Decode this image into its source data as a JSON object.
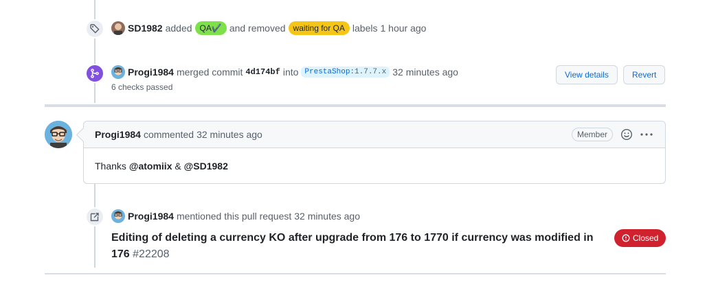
{
  "events": {
    "label_event": {
      "actor": "SD1982",
      "added_text": "added",
      "added_label": "QA✔️",
      "removed_text": "and removed",
      "removed_label": "waiting for QA",
      "suffix": "labels",
      "time": "1 hour ago",
      "icon": "tag-icon"
    },
    "merge_event": {
      "actor": "Progi1984",
      "merged_text": "merged commit",
      "commit_sha": "4d174bf",
      "into_text": "into",
      "branch_owner": "PrestaShop",
      "branch_name": ":1.7.7.x",
      "time": "32 minutes ago",
      "checks": "6 checks passed",
      "view_details_label": "View details",
      "revert_label": "Revert",
      "icon": "git-merge-icon"
    },
    "mention_event": {
      "actor": "Progi1984",
      "text": "mentioned this pull request",
      "time": "32 minutes ago",
      "issue_title": "Editing of deleting a currency KO after upgrade from 176 to 1770 if currency was modified in 176",
      "issue_number": "#22208",
      "status": "Closed",
      "icon": "cross-reference-icon"
    }
  },
  "comment": {
    "actor": "Progi1984",
    "action": "commented",
    "time": "32 minutes ago",
    "role_badge": "Member",
    "body_prefix": "Thanks",
    "mention_1": "@atomiix",
    "joiner": "&",
    "mention_2": "@SD1982"
  },
  "colors": {
    "qa_label": "#7ee04a",
    "waiting_label": "#f5c518",
    "merge_badge": "#8250df",
    "closed_status": "#cf222e",
    "link": "#0969da"
  }
}
